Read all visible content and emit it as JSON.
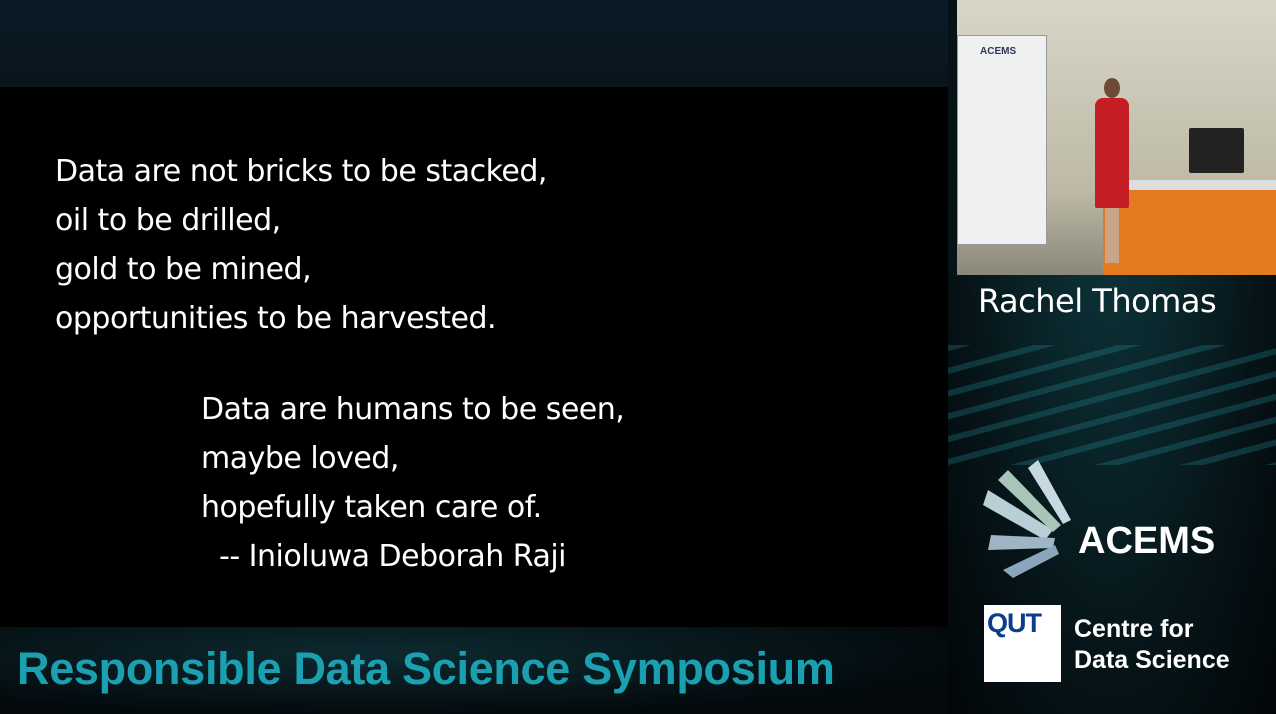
{
  "slide": {
    "stanza1": [
      "Data are not bricks to be stacked,",
      "oil to be drilled,",
      "gold to be mined,",
      "opportunities to be harvested."
    ],
    "stanza2": [
      "Data are humans to be seen,",
      "maybe loved,",
      "hopefully taken care of."
    ],
    "attribution": "-- Inioluwa Deborah Raji"
  },
  "footer": {
    "title": "Responsible Data Science Symposium"
  },
  "speaker": {
    "name": "Rachel Thomas",
    "banner_text": "ACEMS"
  },
  "logos": {
    "acems": "ACEMS",
    "qut": "QUT",
    "centre_line1": "Centre for",
    "centre_line2": "Data Science"
  },
  "colors": {
    "title_teal": "#1aa0b0",
    "qut_blue": "#0a3d8a"
  }
}
